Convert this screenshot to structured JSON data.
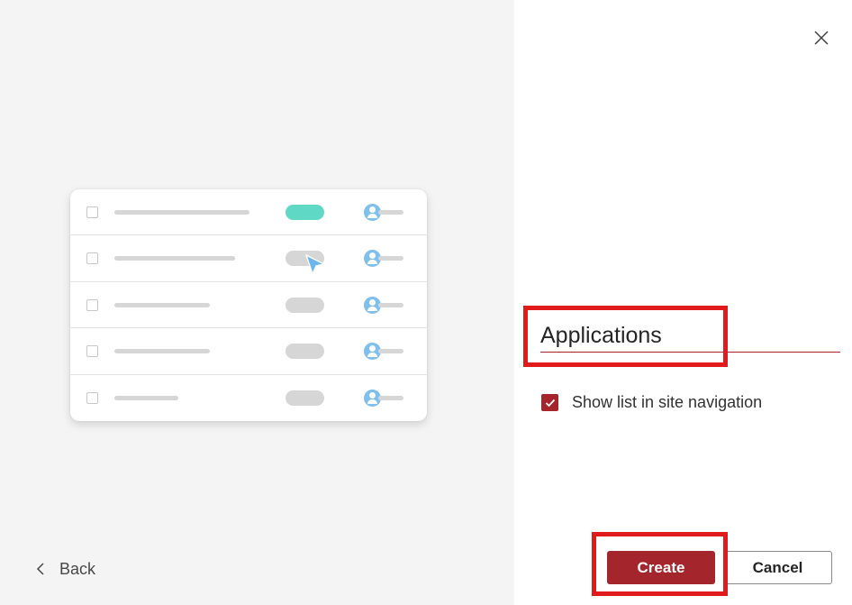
{
  "dialog": {
    "list_name": "Applications",
    "show_in_nav": {
      "label": "Show list in site navigation",
      "checked": true
    },
    "buttons": {
      "create": "Create",
      "cancel": "Cancel",
      "back": "Back"
    },
    "icons": {
      "close": "close-icon",
      "back": "chevron-left-icon",
      "check": "checkmark-icon"
    }
  },
  "colors": {
    "accent": "#a4262c",
    "highlight": "#e11b1b",
    "left_pane_bg": "#f4f4f4",
    "illustration_teal": "#5fd8c6",
    "illustration_blue": "#7fbfee"
  }
}
